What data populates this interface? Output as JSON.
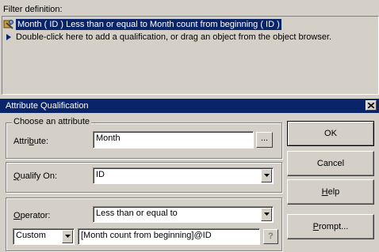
{
  "filter": {
    "label": "Filter definition:",
    "condition": "Month ( ID )  Less than or equal to Month count from beginning ( ID )",
    "hint": "Double-click here to add a qualification, or drag an object from the object browser.",
    "condition_icon": "filter-condition-icon",
    "hint_icon": "arrow-right-icon"
  },
  "dialog": {
    "title": "Attribute Qualification",
    "choose_group": "Choose an attribute",
    "attribute_label_pre": "Attri",
    "attribute_label_ul": "b",
    "attribute_label_post": "ute:",
    "attribute_value": "Month",
    "browse_label": "...",
    "qualify_label_ul": "Q",
    "qualify_label_post": "ualify On:",
    "qualify_value": "ID",
    "operator_label_ul": "O",
    "operator_label_post": "perator:",
    "operator_value": "Less than or equal to",
    "custom_value": "Custom",
    "expression_value": "[Month count from beginning]@ID",
    "help_icon_label": "?",
    "buttons": {
      "ok": "OK",
      "cancel": "Cancel",
      "help_ul": "H",
      "help_post": "elp",
      "prompt_ul": "P",
      "prompt_post": "rompt..."
    }
  },
  "colors": {
    "selection": "#0a246a",
    "face": "#d4d0c8"
  }
}
